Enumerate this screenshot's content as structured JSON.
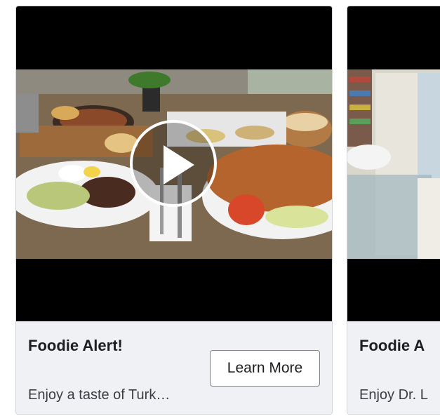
{
  "cards": [
    {
      "title": "Foodie Alert!",
      "description": "Enjoy a taste of Turk…",
      "cta_label": "Learn More",
      "media_icon": "play-icon"
    },
    {
      "title": "Foodie A",
      "description": "Enjoy Dr. L"
    }
  ],
  "colors": {
    "card_background": "#f0f1f5",
    "card_border": "#d3d5da",
    "video_letterbox": "#000000",
    "title_text": "#1c1e21",
    "button_border": "#7f8287"
  }
}
